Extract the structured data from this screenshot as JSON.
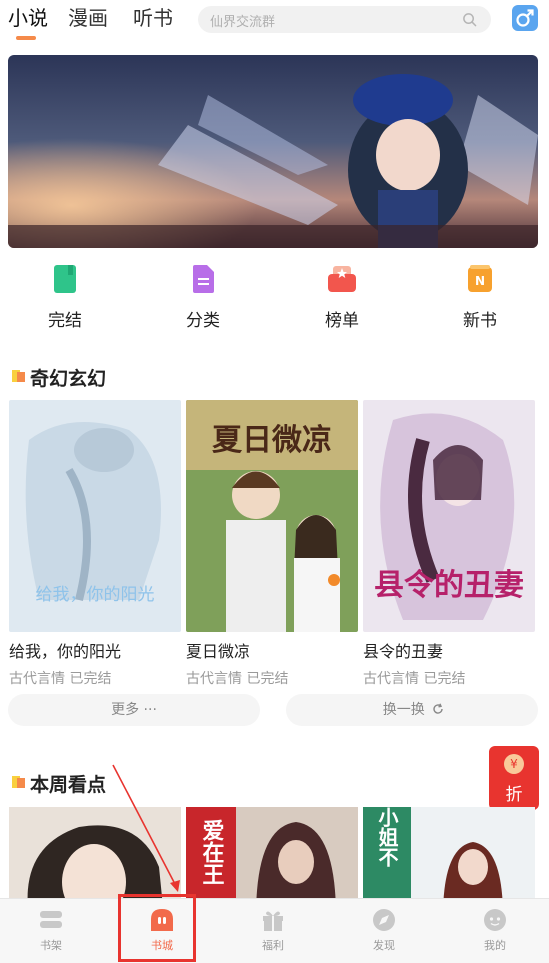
{
  "top_tabs": [
    {
      "label": "小说",
      "active": true
    },
    {
      "label": "漫画",
      "active": false
    },
    {
      "label": "听书",
      "active": false
    }
  ],
  "search": {
    "placeholder": "仙界交流群",
    "icon": "search-icon"
  },
  "gender_icon": "male-icon",
  "quick_nav": [
    {
      "label": "完结",
      "icon": "book-green-icon",
      "color": "#2fc48a"
    },
    {
      "label": "分类",
      "icon": "document-purple-icon",
      "color": "#b86ee8"
    },
    {
      "label": "榜单",
      "icon": "star-card-red-icon",
      "color": "#f2564d"
    },
    {
      "label": "新书",
      "icon": "n-badge-orange-icon",
      "color": "#f7a12e"
    }
  ],
  "section1": {
    "title": "奇幻玄幻",
    "books": [
      {
        "title": "给我，你的阳光",
        "meta": "古代言情 已完结",
        "cover_text": "给我，你的阳光"
      },
      {
        "title": "夏日微凉",
        "meta": "古代言情 已完结",
        "cover_text": "夏日微凉"
      },
      {
        "title": "县令的丑妻",
        "meta": "古代言情 已完结",
        "cover_text": "县令的丑妻"
      }
    ],
    "more_label": "更多 ···",
    "refresh_label": "换一换"
  },
  "discount_badge": {
    "label": "折",
    "coin": "¥"
  },
  "section2": {
    "title": "本周看点",
    "cover_texts": [
      "",
      "爱在王",
      "四小姐不"
    ]
  },
  "bottom_nav": [
    {
      "label": "书架",
      "icon": "bookshelf-icon",
      "active": false
    },
    {
      "label": "书城",
      "icon": "bookstore-icon",
      "active": true
    },
    {
      "label": "福利",
      "icon": "gift-icon",
      "active": false
    },
    {
      "label": "发现",
      "icon": "discover-icon",
      "active": false
    },
    {
      "label": "我的",
      "icon": "profile-icon",
      "active": false
    }
  ],
  "colors": {
    "accent": "#f58a4a",
    "active_nav": "#f26a4b",
    "annotation_red": "#e8342f"
  }
}
